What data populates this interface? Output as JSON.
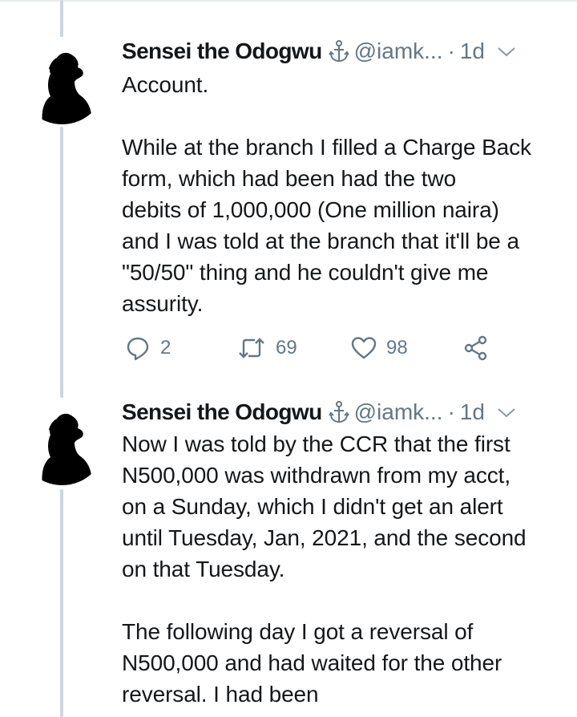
{
  "tweets": [
    {
      "name": "Sensei the Odogwu",
      "handle": "@iamk...",
      "separator": "·",
      "time": "1d",
      "lines": [
        "Account.",
        "",
        "While at the branch I filled a Charge Back",
        "form,  which had been had the two",
        "debits of 1,000,000 (One million naira)",
        "and I was told at the branch that it'll be a",
        "\"50/50\" thing and he couldn't give me",
        "assurity."
      ],
      "replies": "2",
      "retweets": "69",
      "likes": "98"
    },
    {
      "name": "Sensei the Odogwu",
      "handle": "@iamk...",
      "separator": "·",
      "time": "1d",
      "lines": [
        "Now I was told by the CCR that the first",
        "N500,000 was withdrawn from my acct,",
        "on a Sunday, which I didn't get an alert",
        "until Tuesday, Jan, 2021, and the second",
        "on that Tuesday.",
        "",
        "The following day I got a reversal of",
        "N500,000 and had waited for the other",
        "reversal. I had been"
      ]
    }
  ],
  "icons": {
    "name_badge": "anchor-icon",
    "menu": "chevron-down-icon",
    "reply": "reply-icon",
    "retweet": "retweet-icon",
    "like": "heart-icon",
    "share": "share-icon"
  },
  "colors": {
    "text": "#14171a",
    "secondary": "#657786",
    "thread_line": "#ccd6dd"
  }
}
